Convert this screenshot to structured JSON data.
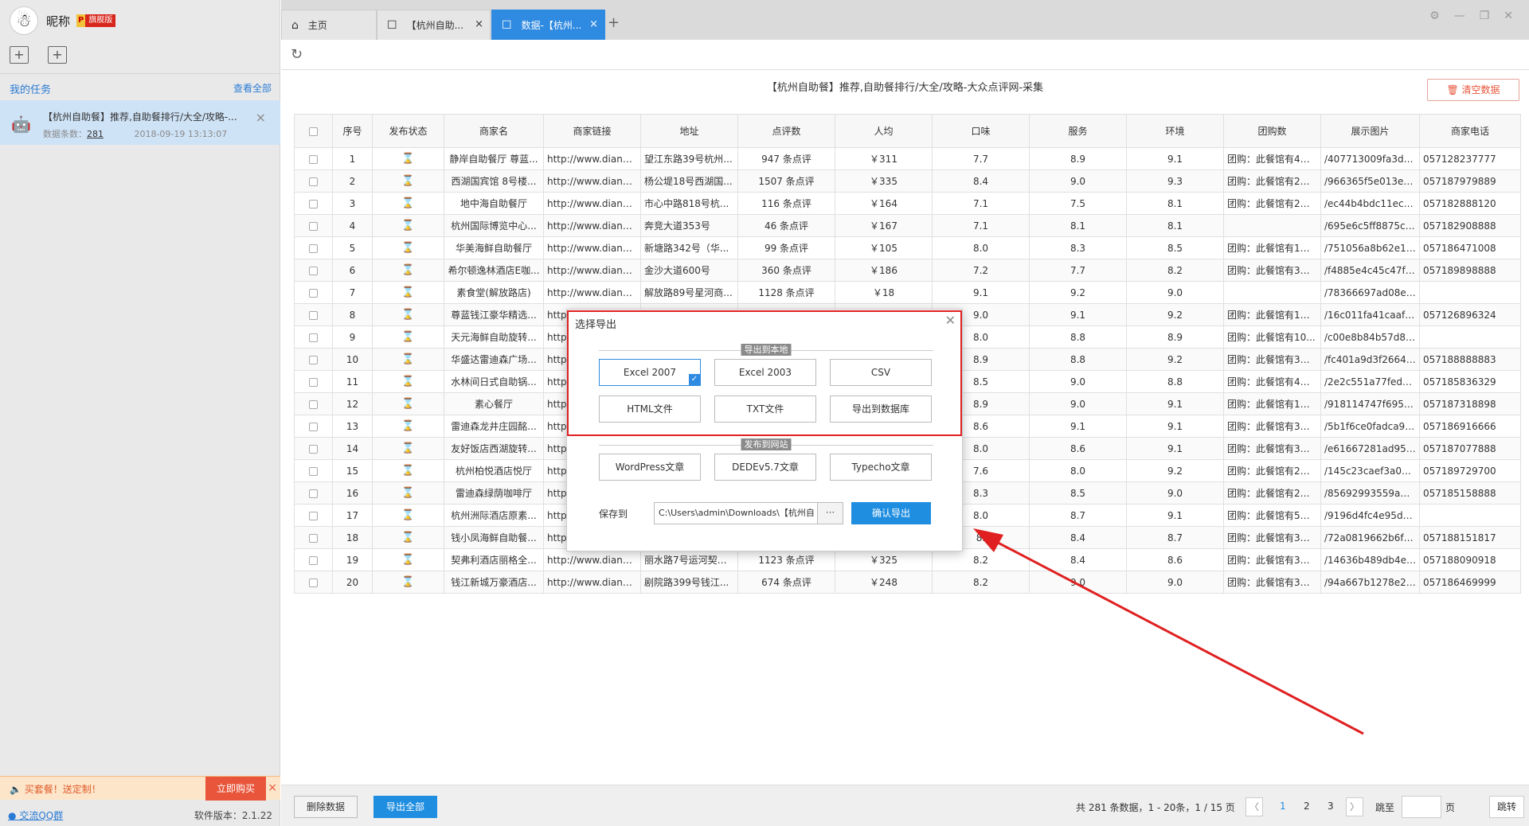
{
  "user": {
    "name": "昵称",
    "badge_p": "P",
    "badge_label": "旗舰版"
  },
  "sidebar": {
    "mytask": "我的任务",
    "viewall": "查看全部",
    "task": {
      "title": "【杭州自助餐】推荐,自助餐排行/大全/攻略-...",
      "count_label": "数据条数：",
      "count": "281",
      "time": "2018-09-19 13:13:07"
    },
    "promo": {
      "text": "买套餐！送定制！",
      "buy": "立即购买"
    },
    "qq": "交流QQ群",
    "version": "软件版本：2.1.22"
  },
  "tabs": [
    {
      "label": "主页"
    },
    {
      "label": "【杭州自助..."
    },
    {
      "label": "数据-【杭州..."
    }
  ],
  "content": {
    "title": "【杭州自助餐】推荐,自助餐排行/大全/攻略-大众点评网-采集",
    "clear": "清空数据"
  },
  "table": {
    "headers": [
      "序号",
      "发布状态",
      "商家名",
      "商家链接",
      "地址",
      "点评数",
      "人均",
      "口味",
      "服务",
      "环境",
      "团购数",
      "展示图片",
      "商家电话"
    ],
    "rows": [
      [
        "1",
        "静岸自助餐厅 尊蓝...",
        "http://www.dianpin...",
        "望江东路39号杭州...",
        "947 条点评",
        "￥311",
        "7.7",
        "8.9",
        "9.1",
        "团购：此餐馆有4个...",
        "/407713009fa3d0...",
        "057128237777"
      ],
      [
        "2",
        "西湖国宾馆 8号楼...",
        "http://www.dianpin...",
        "杨公堤18号西湖国...",
        "1507 条点评",
        "￥335",
        "8.4",
        "9.0",
        "9.3",
        "团购：此餐馆有2个...",
        "/966365f5e013ef3...",
        "057187979889"
      ],
      [
        "3",
        "地中海自助餐厅",
        "http://www.dianpin...",
        "市心中路818号杭...",
        "116 条点评",
        "￥164",
        "7.1",
        "7.5",
        "8.1",
        "团购：此餐馆有2个...",
        "/ec44b4bdc11eca...",
        "057182888120"
      ],
      [
        "4",
        "杭州国际博览中心...",
        "http://www.dianpin...",
        "奔竞大道353号",
        "46 条点评",
        "￥167",
        "7.1",
        "8.1",
        "8.1",
        "",
        "/695e6c5ff8875c8...",
        "057182908888"
      ],
      [
        "5",
        "华美海鲜自助餐厅",
        "http://www.dianpin...",
        "新塘路342号（华...",
        "99 条点评",
        "￥105",
        "8.0",
        "8.3",
        "8.5",
        "团购：此餐馆有1个...",
        "/751056a8b62e1e...",
        "057186471008"
      ],
      [
        "6",
        "希尔顿逸林酒店E咖...",
        "http://www.dianpin...",
        "金沙大道600号",
        "360 条点评",
        "￥186",
        "7.2",
        "7.7",
        "8.2",
        "团购：此餐馆有3个...",
        "/f4885e4c45c47fc...",
        "057189898888"
      ],
      [
        "7",
        "素食堂(解放路店)",
        "http://www.dianpin...",
        "解放路89号星河商...",
        "1128 条点评",
        "￥18",
        "9.1",
        "9.2",
        "9.0",
        "",
        "/78366697ad08e3...",
        ""
      ],
      [
        "8",
        "尊蓝钱江豪华精选...",
        "http:",
        "",
        "",
        "",
        "9.0",
        "9.1",
        "9.2",
        "团购：此餐馆有1个...",
        "/16c011fa41caaf9...",
        "057126896324"
      ],
      [
        "9",
        "天元海鲜自助旋转...",
        "http:",
        "",
        "",
        "",
        "8.0",
        "8.8",
        "8.9",
        "团购：此餐馆有10...",
        "/c00e8b84b57d82...",
        ""
      ],
      [
        "10",
        "华盛达雷迪森广场...",
        "http:",
        "",
        "",
        "",
        "8.9",
        "8.8",
        "9.2",
        "团购：此餐馆有3个...",
        "/fc401a9d3f26646...",
        "057188888883"
      ],
      [
        "11",
        "水林间日式自助锅...",
        "http:",
        "",
        "",
        "",
        "8.5",
        "9.0",
        "8.8",
        "团购：此餐馆有4个...",
        "/2e2c551a77fed05...",
        "057185836329"
      ],
      [
        "12",
        "素心餐厅",
        "http:",
        "",
        "",
        "",
        "8.9",
        "9.0",
        "9.1",
        "团购：此餐馆有1个...",
        "/918114747f695f0...",
        "057187318898"
      ],
      [
        "13",
        "雷迪森龙井庄园酩...",
        "http:",
        "",
        "",
        "",
        "8.6",
        "9.1",
        "9.1",
        "团购：此餐馆有3个...",
        "/5b1f6ce0fadca98...",
        "057186916666"
      ],
      [
        "14",
        "友好饭店西湖旋转...",
        "http:",
        "",
        "",
        "",
        "8.0",
        "8.6",
        "9.1",
        "团购：此餐馆有3个...",
        "/e61667281ad95e...",
        "057187077888"
      ],
      [
        "15",
        "杭州柏悦酒店悦厅",
        "http:",
        "",
        "",
        "",
        "7.6",
        "8.0",
        "9.2",
        "团购：此餐馆有2个...",
        "/145c23caef3a006...",
        "057189729700"
      ],
      [
        "16",
        "雷迪森绿荫咖啡厅",
        "http:",
        "",
        "",
        "",
        "8.3",
        "8.5",
        "9.0",
        "团购：此餐馆有2个...",
        "/85692993559a05...",
        "057185158888"
      ],
      [
        "17",
        "杭州洲际酒店原素...",
        "http:",
        "",
        "",
        "",
        "8.0",
        "8.7",
        "9.1",
        "团购：此餐馆有5个...",
        "/9196d4fc4e95db4...",
        ""
      ],
      [
        "18",
        "钱小凤海鲜自助餐...",
        "http:",
        "",
        "",
        "",
        "8.",
        "8.4",
        "8.7",
        "团购：此餐馆有3个...",
        "/72a0819662b6f4...",
        "057188151817"
      ],
      [
        "19",
        "契弗利酒店丽格全...",
        "http://www.dianpin...",
        "丽水路7号运河契弗...",
        "1123 条点评",
        "￥325",
        "8.2",
        "8.4",
        "8.6",
        "团购：此餐馆有3个...",
        "/14636b489db4e6...",
        "057188090918"
      ],
      [
        "20",
        "钱江新城万豪酒店...",
        "http://www.dianpin...",
        "剧院路399号钱江...",
        "674 条点评",
        "￥248",
        "8.2",
        "9.0",
        "9.0",
        "团购：此餐馆有3个...",
        "/94a667b1278e28...",
        "057186469999"
      ]
    ]
  },
  "bottom": {
    "delete": "删除数据",
    "export_all": "导出全部",
    "info": "共 281 条数据，1 - 20条，1 / 15 页",
    "pages": [
      "1",
      "2",
      "3"
    ],
    "jump_to": "跳至",
    "page_unit": "页",
    "jump": "跳转"
  },
  "dialog": {
    "title": "选择导出",
    "local_label": "导出到本地",
    "local": [
      "Excel 2007",
      "Excel 2003",
      "CSV",
      "HTML文件",
      "TXT文件",
      "导出到数据库"
    ],
    "web_label": "发布到网站",
    "web": [
      "WordPress文章",
      "DEDEv5.7文章",
      "Typecho文章"
    ],
    "save_label": "保存到",
    "path": "C:\\Users\\admin\\Downloads\\【杭州自",
    "dots": "···",
    "confirm": "确认导出"
  },
  "colors": {
    "accent": "#1f8ee0",
    "tab_active": "#2f8ae1",
    "highlight": "#e02020",
    "status_icon": "#1aa34a"
  },
  "icons": {
    "status": "hourglass-icon",
    "refresh": "refresh-icon",
    "home": "home-icon"
  }
}
